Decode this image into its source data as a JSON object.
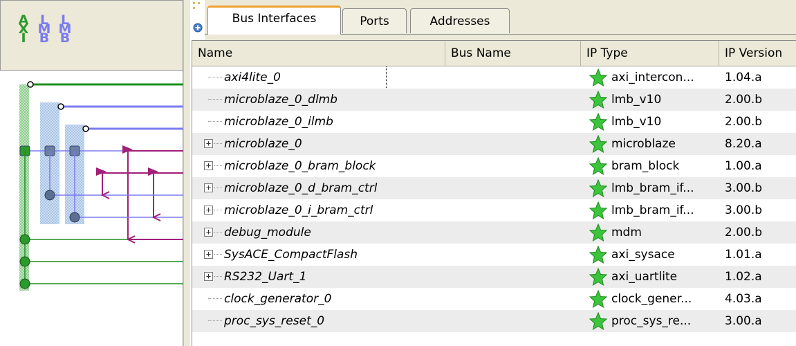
{
  "bus_header": {
    "columns": [
      {
        "letters": [
          "A",
          "X",
          "I"
        ],
        "color": "#2e9a2e"
      },
      {
        "letters": [
          "L",
          "M",
          "B"
        ],
        "color": "#7b7bf0"
      },
      {
        "letters": [
          "L",
          "M",
          "B"
        ],
        "color": "#7b7bf0"
      }
    ]
  },
  "tabs": [
    {
      "label": "Bus Interfaces",
      "active": true
    },
    {
      "label": "Ports",
      "active": false
    },
    {
      "label": "Addresses",
      "active": false
    }
  ],
  "table": {
    "headers": {
      "name": "Name",
      "bus_name": "Bus Name",
      "ip_type": "IP Type",
      "ip_version": "IP Version"
    },
    "rows": [
      {
        "name": "axi4lite_0",
        "expandable": false,
        "ip_type": "axi_intercon...",
        "ip_version": "1.04.a",
        "focused": true
      },
      {
        "name": "microblaze_0_dlmb",
        "expandable": false,
        "ip_type": "lmb_v10",
        "ip_version": "2.00.b"
      },
      {
        "name": "microblaze_0_ilmb",
        "expandable": false,
        "ip_type": "lmb_v10",
        "ip_version": "2.00.b"
      },
      {
        "name": "microblaze_0",
        "expandable": true,
        "ip_type": "microblaze",
        "ip_version": "8.20.a"
      },
      {
        "name": "microblaze_0_bram_block",
        "expandable": true,
        "ip_type": "bram_block",
        "ip_version": "1.00.a"
      },
      {
        "name": "microblaze_0_d_bram_ctrl",
        "expandable": true,
        "ip_type": "lmb_bram_if...",
        "ip_version": "3.00.b"
      },
      {
        "name": "microblaze_0_i_bram_ctrl",
        "expandable": true,
        "ip_type": "lmb_bram_if...",
        "ip_version": "3.00.b"
      },
      {
        "name": "debug_module",
        "expandable": true,
        "ip_type": "mdm",
        "ip_version": "2.00.b"
      },
      {
        "name": "SysACE_CompactFlash",
        "expandable": true,
        "ip_type": "axi_sysace",
        "ip_version": "1.01.a"
      },
      {
        "name": "RS232_Uart_1",
        "expandable": true,
        "ip_type": "axi_uartlite",
        "ip_version": "1.02.a"
      },
      {
        "name": "clock_generator_0",
        "expandable": false,
        "ip_type": "clock_gener...",
        "ip_version": "4.03.a"
      },
      {
        "name": "proc_sys_reset_0",
        "expandable": false,
        "ip_type": "proc_sys_re...",
        "ip_version": "3.00.a"
      }
    ]
  },
  "icons": {
    "ip_type_icon": "green-star-icon",
    "expander_icon": "plus-expander-icon",
    "toolbar_icon": "expand-all-icon"
  },
  "colors": {
    "axi_bus": "#1f8f1f",
    "lmb_bus": "#7b7bf0",
    "connector_arrow": "#a0207a",
    "active_tab_accent": "#f0a030",
    "star": "#3cc43c"
  }
}
